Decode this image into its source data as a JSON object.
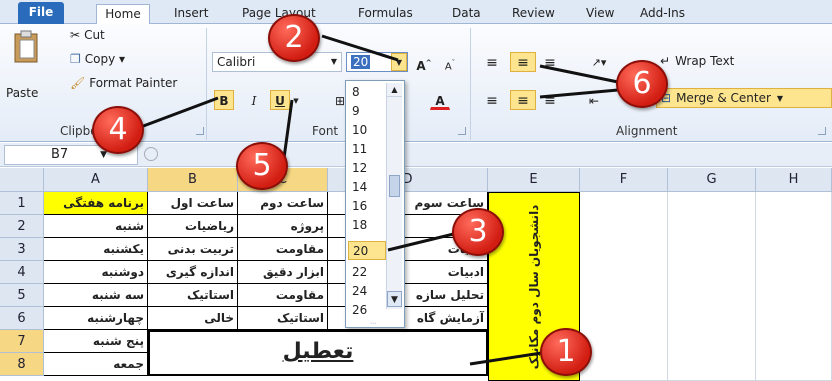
{
  "tabs": [
    "File",
    "Home",
    "Insert",
    "Page Layout",
    "Formulas",
    "Data",
    "Review",
    "View",
    "Add-Ins"
  ],
  "clipboard": {
    "paste": "Paste",
    "cut": "Cut",
    "copy": "Copy ▾",
    "format_painter": "Format Painter",
    "group_label": "Clipboard"
  },
  "font": {
    "name": "Calibri",
    "size": "20",
    "group_label": "Font"
  },
  "alignment": {
    "wrap_text": "Wrap Text",
    "merge_center": "Merge & Center",
    "group_label": "Alignment"
  },
  "formula_bar": {
    "name_box": "B7"
  },
  "columns": [
    "A",
    "B",
    "C",
    "D",
    "E",
    "F",
    "G",
    "H"
  ],
  "rows": [
    "1",
    "2",
    "3",
    "4",
    "5",
    "6",
    "7",
    "8"
  ],
  "cells": {
    "A": [
      "برنامه هفتگی",
      "شنبه",
      "یکشنبه",
      "دوشنبه",
      "سه شنبه",
      "چهارشنبه",
      "پنج شنبه",
      "جمعه"
    ],
    "B": [
      "ساعت اول",
      "ریاضیات",
      "تربیت بدنی",
      "اندازه گیری",
      "استاتیک",
      "خالی"
    ],
    "C": [
      "ساعت دوم",
      "پروژه",
      "مقاومت",
      "ابزار دقیق",
      "مقاومت",
      "استاتیک"
    ],
    "D": [
      "ساعت سوم",
      "",
      "ادبیات",
      "ادبیات",
      "تحلیل سازه",
      "آزمایش گاه"
    ],
    "E_vertical": "دانشجویان سال دوم مکانیک"
  },
  "merged_cell_text": "تعطیل",
  "font_size_options": [
    "8",
    "9",
    "10",
    "11",
    "12",
    "14",
    "16",
    "18",
    "20",
    "22",
    "24",
    "26"
  ],
  "selected_font_size": "20",
  "callouts": [
    "1",
    "2",
    "3",
    "4",
    "5",
    "6"
  ],
  "colors": {
    "yellow_fill": "#ffff00",
    "highlight": "#fde58f",
    "callout_red": "#d21d12"
  }
}
